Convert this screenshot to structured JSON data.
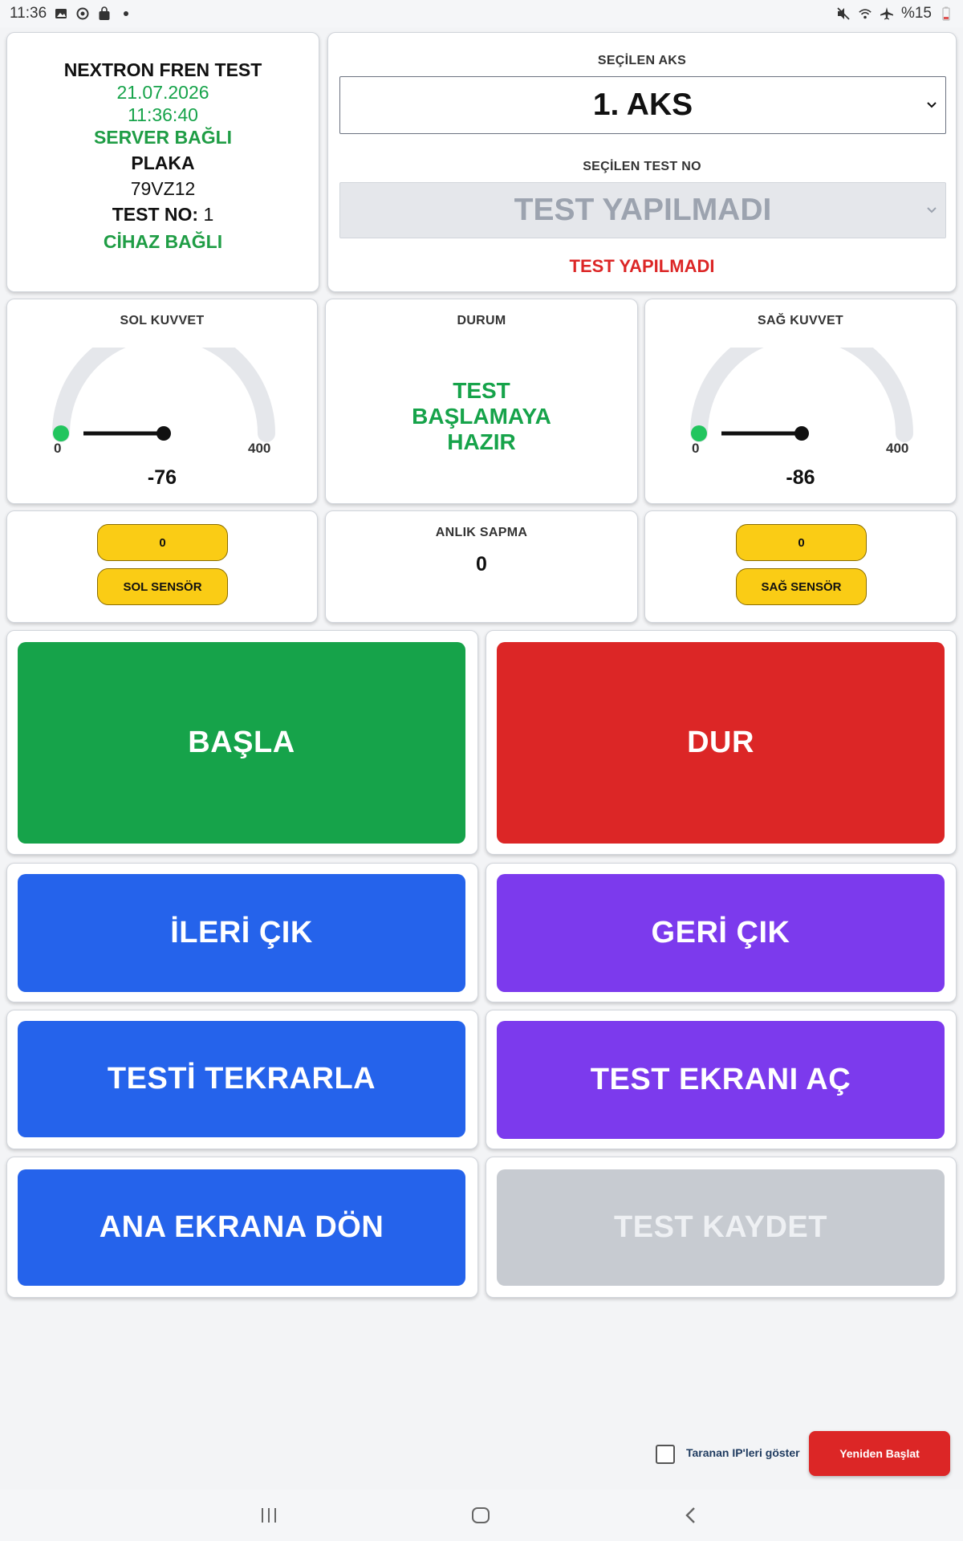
{
  "status_bar": {
    "time": "11:36",
    "battery": "%15",
    "icons": [
      "image-icon",
      "sync-icon",
      "bag-icon",
      "dot-icon",
      "mute-icon",
      "wifi-icon",
      "airplane-icon",
      "battery-icon"
    ]
  },
  "info": {
    "title": "NEXTRON FREN TEST",
    "date": "21.07.2026",
    "time": "11:36:40",
    "server_status": "SERVER BAĞLI",
    "plate_label": "PLAKA",
    "plate_value": "79VZ12",
    "test_no_label": "TEST NO:",
    "test_no_value": "1",
    "device_status": "CİHAZ BAĞLI"
  },
  "selection": {
    "axle_label": "SEÇİLEN AKS",
    "axle_value": "1. AKS",
    "test_no_label": "SEÇİLEN TEST NO",
    "test_no_value": "TEST YAPILMADI",
    "test_status": "TEST YAPILMADI"
  },
  "left_force": {
    "label": "SOL KUVVET",
    "min": "0",
    "max": "400",
    "value": "-76",
    "level": -76
  },
  "status": {
    "label": "DURUM",
    "line1": "TEST",
    "line2": "BAŞLAMAYA",
    "line3": "HAZIR"
  },
  "right_force": {
    "label": "SAĞ KUVVET",
    "min": "0",
    "max": "400",
    "value": "-86",
    "level": -86
  },
  "left_sensor": {
    "value": "0",
    "button": "SOL SENSÖR"
  },
  "deviation": {
    "label": "ANLIK SAPMA",
    "value": "0"
  },
  "right_sensor": {
    "value": "0",
    "button": "SAĞ SENSÖR"
  },
  "buttons": {
    "start": "BAŞLA",
    "stop": "DUR",
    "forward": "İLERİ ÇIK",
    "back": "GERİ ÇIK",
    "repeat": "TESTİ TEKRARLA",
    "open_test_screen": "TEST EKRANI AÇ",
    "home": "ANA EKRANA DÖN",
    "save": "TEST KAYDET"
  },
  "footer": {
    "show_ips_label": "Taranan IP'leri göster",
    "restart_label": "Yeniden Başlat"
  },
  "colors": {
    "green": "#16a34a",
    "red": "#dc2626",
    "blue": "#2563eb",
    "purple": "#7c3aed",
    "disabled": "#c7cbd1",
    "yellow": "#facc15"
  }
}
